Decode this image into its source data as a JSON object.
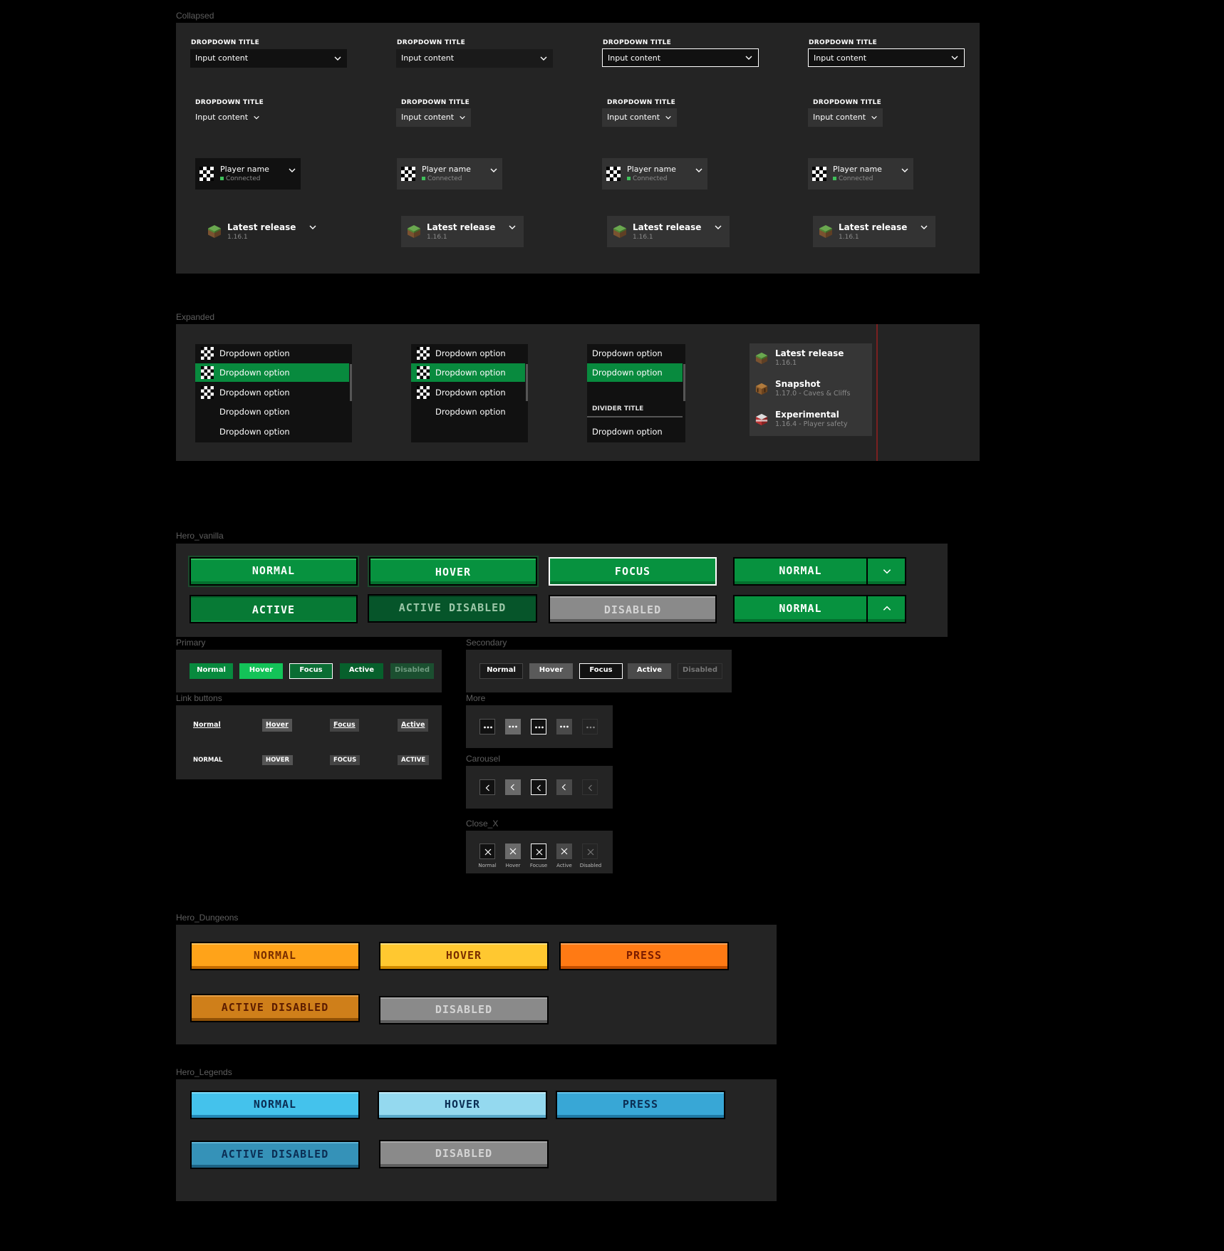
{
  "sections": {
    "collapsed": "Collapsed",
    "expanded": "Expanded",
    "hero_vanilla": "Hero_vanilla",
    "primary": "Primary",
    "secondary": "Secondary",
    "link_buttons": "Link buttons",
    "more": "More",
    "carousel": "Carousel",
    "close_x": "Close_X",
    "hero_dungeons": "Hero_Dungeons",
    "hero_legends": "Hero_Legends"
  },
  "dropdown": {
    "title": "DROPDOWN TITLE",
    "value": "Input content"
  },
  "player": {
    "name": "Player name",
    "status": "Connected",
    "status_color": "#3fbf5a"
  },
  "release": {
    "name": "Latest release",
    "version": "1.16.1"
  },
  "expanded": {
    "option": "Dropdown option",
    "divider_title": "DIVIDER TITLE",
    "selected_color": "#088a3e",
    "versions": [
      {
        "name": "Latest release",
        "version": "1.16.1",
        "icon": "grass-block-icon"
      },
      {
        "name": "Snapshot",
        "version": "1.17.0 - Caves & Cliffs",
        "icon": "crafting-table-icon"
      },
      {
        "name": "Experimental",
        "version": "1.16.4 - Player safety",
        "icon": "tnt-icon"
      }
    ]
  },
  "hero_vanilla": {
    "normal": "NORMAL",
    "hover": "HOVER",
    "focus": "FOCUS",
    "active": "ACTIVE",
    "active_disabled": "ACTIVE DISABLED",
    "disabled": "DISABLED",
    "color": "#07923f"
  },
  "primary": {
    "normal": "Normal",
    "hover": "Hover",
    "focus": "Focus",
    "active": "Active",
    "disabled": "Disabled"
  },
  "secondary": {
    "normal": "Normal",
    "hover": "Hover",
    "focus": "Focus",
    "active": "Active",
    "disabled": "Disabled"
  },
  "link_buttons": {
    "normal": "Normal",
    "hover": "Hover",
    "focus": "Focus",
    "active": "Active",
    "normal_caps": "NORMAL",
    "hover_caps": "HOVER",
    "focus_caps": "FOCUS",
    "active_caps": "ACTIVE"
  },
  "close_x": {
    "normal": "Normal",
    "hover": "Hover",
    "focus": "Focuse",
    "active": "Active",
    "disabled": "Disabled"
  },
  "hero_dungeons": {
    "normal": "NORMAL",
    "hover": "HOVER",
    "press": "PRESS",
    "active_disabled": "ACTIVE DISABLED",
    "disabled": "DISABLED",
    "color": "#ffa319"
  },
  "hero_legends": {
    "normal": "NORMAL",
    "hover": "HOVER",
    "press": "PRESS",
    "active_disabled": "ACTIVE DISABLED",
    "disabled": "DISABLED",
    "color": "#44c2ec"
  }
}
